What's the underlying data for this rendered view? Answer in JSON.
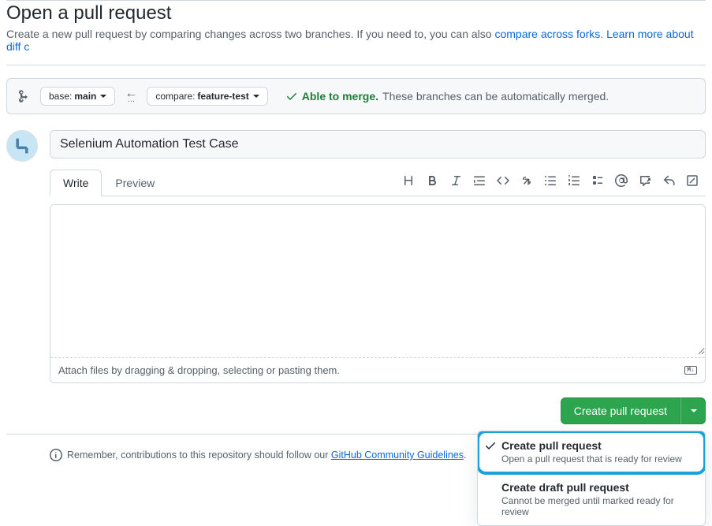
{
  "header": {
    "title": "Open a pull request",
    "subtitle_pre": "Create a new pull request by comparing changes across two branches. If you need to, you can also ",
    "link1": "compare across forks",
    "dot": ". ",
    "link2": "Learn more about diff c"
  },
  "branches": {
    "base_label": "base:",
    "base_value": "main",
    "compare_label": "compare:",
    "compare_value": "feature-test"
  },
  "merge": {
    "ok": "Able to merge.",
    "desc": "These branches can be automatically merged."
  },
  "form": {
    "title_value": "Selenium Automation Test Case",
    "body_value": "",
    "attach_hint": "Attach files by dragging & dropping, selecting or pasting them."
  },
  "tabs": {
    "write": "Write",
    "preview": "Preview"
  },
  "actions": {
    "primary": "Create pull request"
  },
  "dropdown": {
    "item1_title": "Create pull request",
    "item1_desc": "Open a pull request that is ready for review",
    "item2_title": "Create draft pull request",
    "item2_desc": "Cannot be merged until marked ready for review"
  },
  "guidelines": {
    "pre": "Remember, contributions to this repository should follow our ",
    "link": "GitHub Community Guidelines",
    "post": "."
  },
  "md_badge": "M↓"
}
